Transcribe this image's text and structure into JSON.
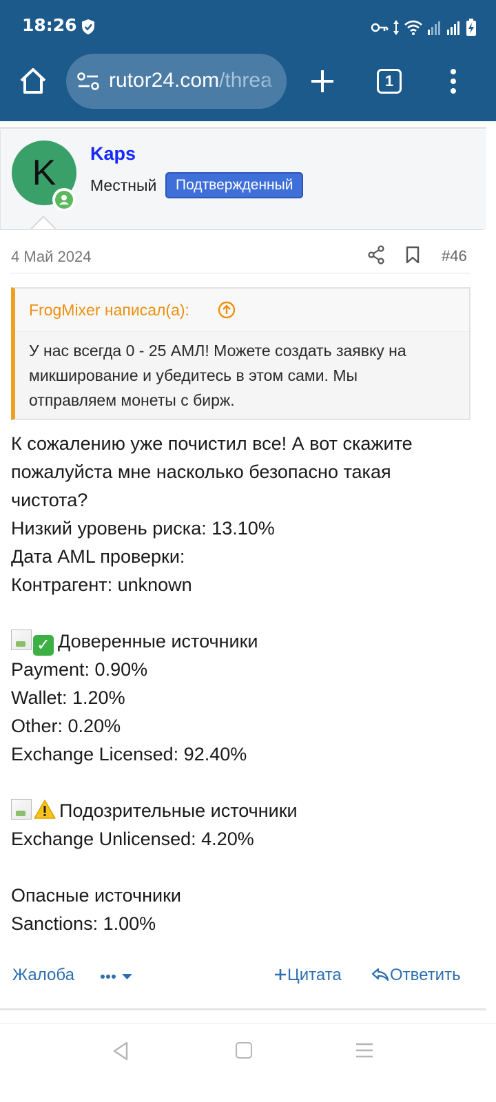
{
  "status_bar": {
    "time": "18:26"
  },
  "browser": {
    "url_main": "rutor24.com",
    "url_path": "/threa",
    "tab_count": "1"
  },
  "post": {
    "avatar_letter": "K",
    "username": "Kaps",
    "user_title": "Местный",
    "badge": "Подтвержденный",
    "date": "4 Май 2024",
    "post_number": "#46",
    "quote": {
      "author": "FrogMixer написал(а):",
      "lines": [
        "У нас всегда 0 - 25 АМЛ! Можете создать заявку на",
        "микширование и убедитесь в этом сами. Мы",
        "отправляем монеты с бирж."
      ]
    },
    "body": {
      "intro": [
        "К сожалению уже почистил все! А вот скажите",
        "пожалуйста мне насколько безопасно такая",
        "чистота?",
        "Низкий уровень риска: 13.10%",
        "Дата AML проверки:",
        "Контрагент: unknown"
      ],
      "trusted_heading": "Доверенные источники",
      "trusted": [
        "Payment: 0.90%",
        "Wallet: 1.20%",
        "Other: 0.20%",
        "Exchange Licensed: 92.40%"
      ],
      "suspicious_heading": "Подозрительные источники",
      "suspicious": [
        "Exchange Unlicensed: 4.20%"
      ],
      "dangerous_heading": "Опасные источники",
      "dangerous": [
        "Sanctions: 1.00%"
      ]
    },
    "actions": {
      "report": "Жалоба",
      "more": "•••",
      "quote": "Цитата",
      "reply": "Ответить"
    }
  },
  "colors": {
    "chrome": "#1c5a8c",
    "username": "#1428ff",
    "badge": "#3f6fd9",
    "quote_accent": "#f0a020",
    "link": "#2b6fb0",
    "avatar": "#3aa06a"
  }
}
